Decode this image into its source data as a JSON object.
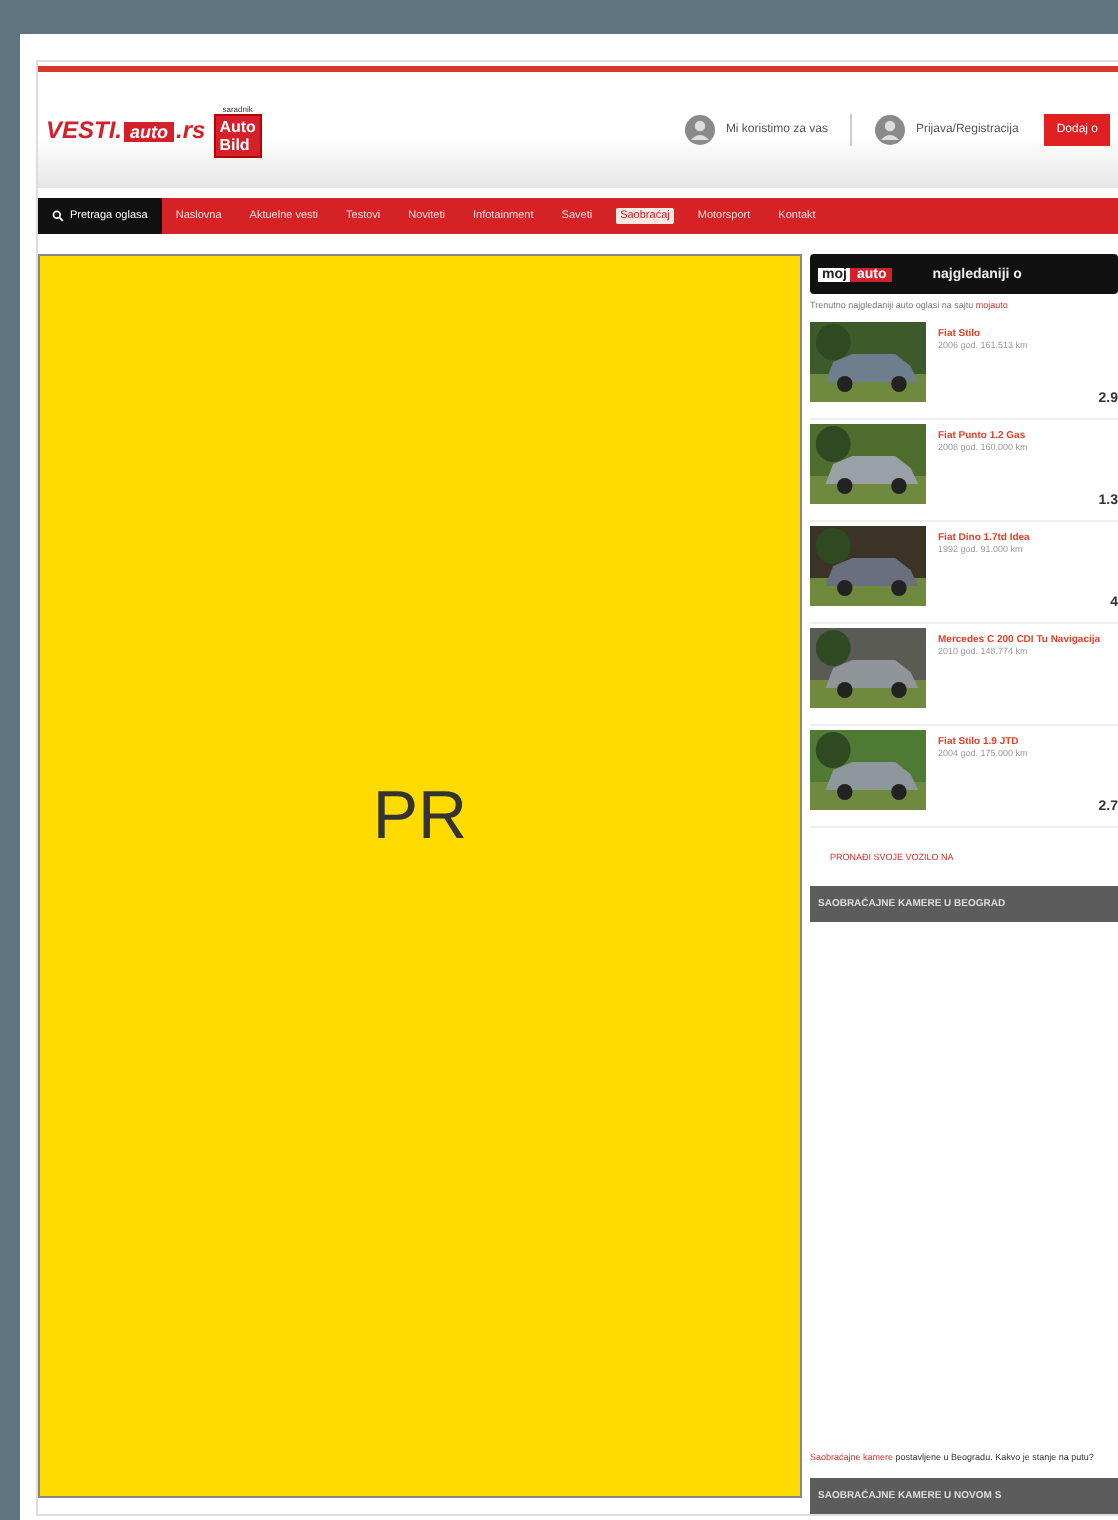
{
  "header": {
    "logo_text": "VESTI.",
    "logo_auto": "auto",
    "logo_domain": ".rs",
    "partner_caption": "saradnik",
    "partner_logo": [
      "Auto",
      "Bild"
    ],
    "links": [
      {
        "label": "Mi koristimo za vas"
      },
      {
        "label": "Prijava/Registracija"
      }
    ],
    "cta": "Dodaj o"
  },
  "nav": {
    "search_label": "Pretraga oglasa",
    "items": [
      {
        "label": "Naslovna",
        "selected": false
      },
      {
        "label": "Aktuelne vesti",
        "selected": false
      },
      {
        "label": "Testovi",
        "selected": false
      },
      {
        "label": "Noviteti",
        "selected": false
      },
      {
        "label": "Infotainment",
        "selected": false
      },
      {
        "label": "Saveti",
        "selected": false
      },
      {
        "label": "Saobraćaj",
        "selected": true
      },
      {
        "label": "Motorsport",
        "selected": false
      },
      {
        "label": "Kontakt",
        "selected": false
      }
    ]
  },
  "ad": {
    "label": "PR"
  },
  "sidebar": {
    "brand": [
      "moj",
      "auto"
    ],
    "title": "najgledaniji o",
    "intro": "Trenutno najgledaniji auto oglasi na sajtu",
    "intro_link": "mojauto",
    "listings": [
      {
        "title": "Fiat Stilo",
        "details": "2006 god. 161.513 km",
        "price": "2.9"
      },
      {
        "title": "Fiat Punto 1.2 Gas",
        "details": "2008 god. 160.000 km",
        "price": "1.3"
      },
      {
        "title": "Fiat Dino 1.7td Idea",
        "details": "1992 god. 91.000 km",
        "price": "4"
      },
      {
        "title": "Mercedes C 200 CDI Tu Navigacija",
        "details": "2010 god. 148.774 km"
      },
      {
        "title": "Fiat Stilo 1.9 JTD",
        "details": "2004 god. 175.000 km",
        "price": "2.7"
      }
    ],
    "more_link": "PRONAĐI SVOJE VOZILO NA",
    "section_a": "SAOBRAĆAJNE KAMERE U BEOGRAD",
    "note_link": "Saobraćajne kamere",
    "note_text": "postavljene u Beogradu. Kakvo je stanje na putu?",
    "section_b": "SAOBRAĆAJNE KAMERE U NOVOM S"
  }
}
